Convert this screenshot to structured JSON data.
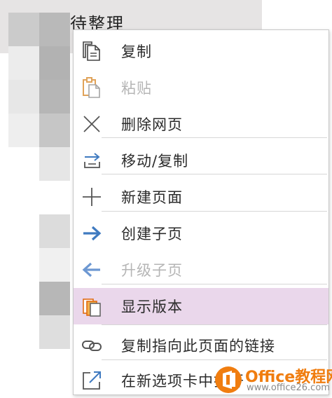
{
  "background": {
    "title": "待整理"
  },
  "menu": {
    "items": [
      {
        "label": "复制",
        "icon": "copy-icon",
        "enabled": true
      },
      {
        "label": "粘贴",
        "icon": "paste-icon",
        "enabled": false
      },
      {
        "label": "删除网页",
        "icon": "close-icon",
        "enabled": true
      },
      {
        "label": "移动/复制",
        "icon": "move-icon",
        "enabled": true
      },
      {
        "label": "新建页面",
        "icon": "plus-icon",
        "enabled": true
      },
      {
        "label": "创建子页",
        "icon": "arrow-right-icon",
        "enabled": true
      },
      {
        "label": "升级子页",
        "icon": "arrow-left-icon",
        "enabled": false
      },
      {
        "label": "显示版本",
        "icon": "versions-icon",
        "enabled": true,
        "highlighted": true
      },
      {
        "label": "复制指向此页面的链接",
        "icon": "link-icon",
        "enabled": true
      },
      {
        "label": "在新选项卡中打开",
        "icon": "open-new-tab-icon",
        "enabled": true
      }
    ]
  },
  "watermark": {
    "brand": "Office教程网",
    "url": "www.office26.com"
  },
  "colors": {
    "highlight": "#ead7eb",
    "accent_blue": "#3f7ac0",
    "accent_orange": "#e06b12",
    "disabled_text": "#b5b5b5"
  }
}
